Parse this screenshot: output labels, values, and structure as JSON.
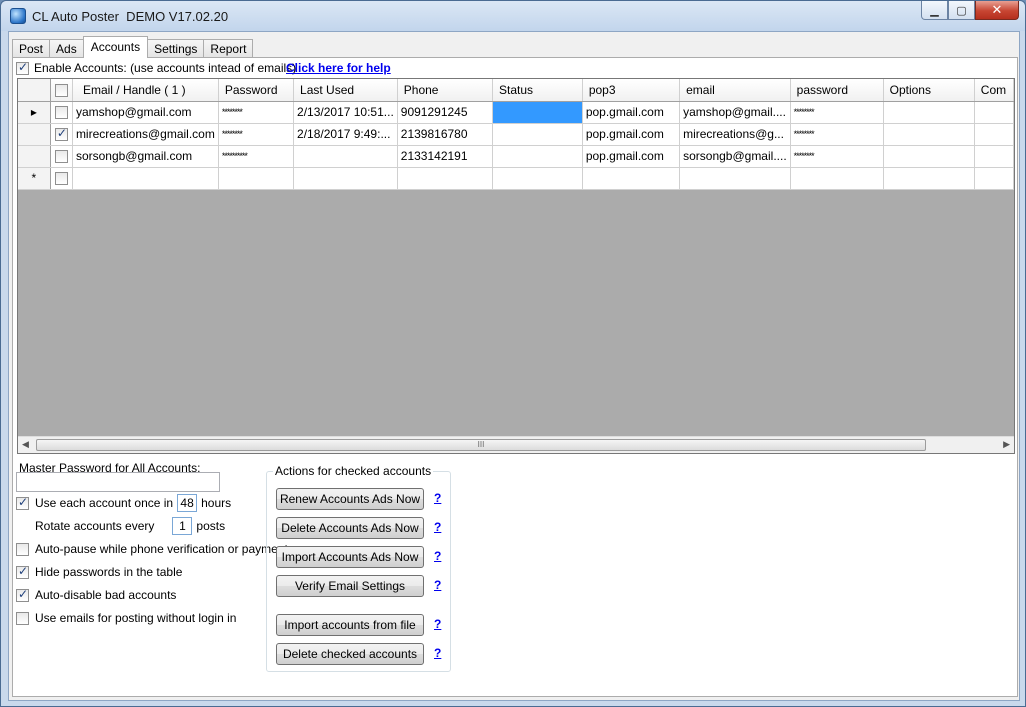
{
  "window": {
    "title": "CL Auto Poster  DEMO V17.02.20"
  },
  "tabs": [
    "Post",
    "Ads",
    "Accounts",
    "Settings",
    "Report"
  ],
  "active_tab": "Accounts",
  "enable_accounts": {
    "label": "Enable Accounts: (use accounts intead of emails)",
    "checked": true
  },
  "help_link": "Click here for help",
  "grid": {
    "columns": [
      "Email / Handle ( 1 )",
      "Password",
      "Last Used",
      "Phone",
      "Status",
      "pop3",
      "email",
      "password",
      "Options",
      "Com"
    ],
    "rows": [
      {
        "marker": "▸",
        "checked": false,
        "cells": [
          "yamshop@gmail.com",
          "********",
          "2/13/2017 10:51...",
          "9091291245",
          "",
          "pop.gmail.com",
          "yamshop@gmail....",
          "********",
          "",
          ""
        ]
      },
      {
        "marker": "",
        "checked": true,
        "cells": [
          "mirecreations@gmail.com",
          "********",
          "2/18/2017 9:49:...",
          "2139816780",
          "",
          "pop.gmail.com",
          "mirecreations@g...",
          "********",
          "",
          ""
        ]
      },
      {
        "marker": "",
        "checked": false,
        "cells": [
          "sorsongb@gmail.com",
          "**********",
          "",
          "2133142191",
          "",
          "pop.gmail.com",
          "sorsongb@gmail....",
          "********",
          "",
          ""
        ]
      },
      {
        "marker": "*",
        "checked": false,
        "cells": [
          "",
          "",
          "",
          "",
          "",
          "",
          "",
          "",
          "",
          ""
        ]
      }
    ],
    "scroll_grip": "III"
  },
  "master_password": {
    "label": "Master Password for All Accounts:",
    "value": ""
  },
  "options": {
    "use_each_prefix": "Use each account once in",
    "use_each_hours": "48",
    "use_each_suffix": "hours",
    "use_each_checked": true,
    "rotate_prefix": "Rotate accounts  every",
    "rotate_posts": "1",
    "rotate_suffix": "posts",
    "auto_pause": "Auto-pause while phone verification or payment",
    "auto_pause_checked": false,
    "hide_passwords": "Hide passwords in the table",
    "hide_passwords_checked": true,
    "auto_disable": "Auto-disable bad accounts",
    "auto_disable_checked": true,
    "use_emails": "Use emails for posting without login in",
    "use_emails_checked": false
  },
  "actions": {
    "title": "Actions for checked accounts",
    "renew": "Renew Accounts Ads Now",
    "delete_ads": "Delete Accounts Ads Now",
    "import_ads": "Import Accounts Ads Now",
    "verify": "Verify Email Settings",
    "import_file": "Import accounts from file",
    "delete_checked": "Delete checked accounts",
    "help_q": "?"
  },
  "colors": {
    "selection": "#3399ff",
    "link": "#0000ee",
    "titlebar": "#c2d5ec"
  }
}
